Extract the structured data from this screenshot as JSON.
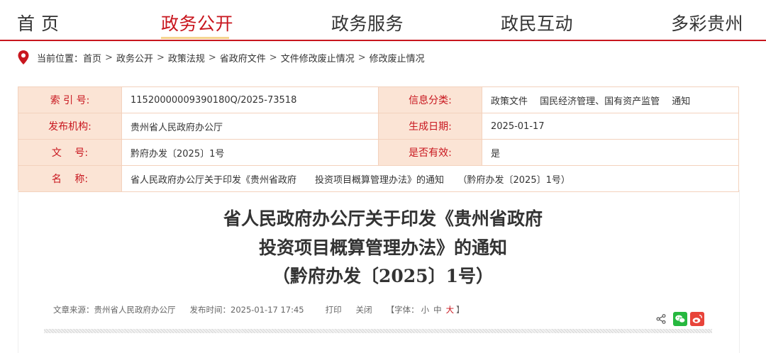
{
  "nav": {
    "items": [
      {
        "label": "首 页",
        "name": "nav-item-home",
        "active": false
      },
      {
        "label": "政务公开",
        "name": "nav-item-gov-affairs",
        "active": true
      },
      {
        "label": "政务服务",
        "name": "nav-item-gov-services",
        "active": false
      },
      {
        "label": "政民互动",
        "name": "nav-item-interaction",
        "active": false
      },
      {
        "label": "多彩贵州",
        "name": "nav-item-colorful-guizhou",
        "active": false
      }
    ]
  },
  "breadcrumb": {
    "prefix": "当前位置：",
    "separator": ">",
    "items": [
      "首页",
      "政务公开",
      "政策法规",
      "省政府文件",
      "文件修改废止情况",
      "修改废止情况"
    ]
  },
  "info": {
    "index_label": "索  引  号:",
    "index_value": "11520000009390180Q/2025-73518",
    "category_label": "信息分类:",
    "category_value": "政策文件　 国民经济管理、国有资产监管　 通知",
    "issuer_label": "发布机构:",
    "issuer_value": "贵州省人民政府办公厅",
    "date_label": "生成日期:",
    "date_value": "2025-01-17",
    "docno_label": "文　  号:",
    "docno_value": "黔府办发〔2025〕1号",
    "valid_label": "是否有效:",
    "valid_value": "是",
    "name_label": "名　  称:",
    "name_value": "省人民政府办公厅关于印发《贵州省政府　　投资项目概算管理办法》的通知　　（黔府办发〔2025〕1号）"
  },
  "article": {
    "title_lines": [
      "省人民政府办公厅关于印发《贵州省政府",
      "投资项目概算管理办法》的通知",
      "（黔府办发〔2025〕1号）"
    ],
    "meta": {
      "source": "文章来源：贵州省人民政府办公厅",
      "time": "发布时间：2025-01-17 17:45",
      "print": "打印",
      "close": "关闭",
      "font_open": "【字体：",
      "font_small": "小",
      "font_medium": "中",
      "font_large": "大",
      "font_close": "】"
    }
  },
  "colors": {
    "brand_red": "#c8161e",
    "label_bg": "#fbe4d5",
    "table_border": "#f3d2bd",
    "nav_underline": "#f5d48f",
    "wechat_green": "#26b83f",
    "weibo_red": "#e8443a"
  },
  "icons": {
    "location": "location-pin-icon",
    "share": "share-icon",
    "wechat": "wechat-icon",
    "weibo": "weibo-icon"
  }
}
